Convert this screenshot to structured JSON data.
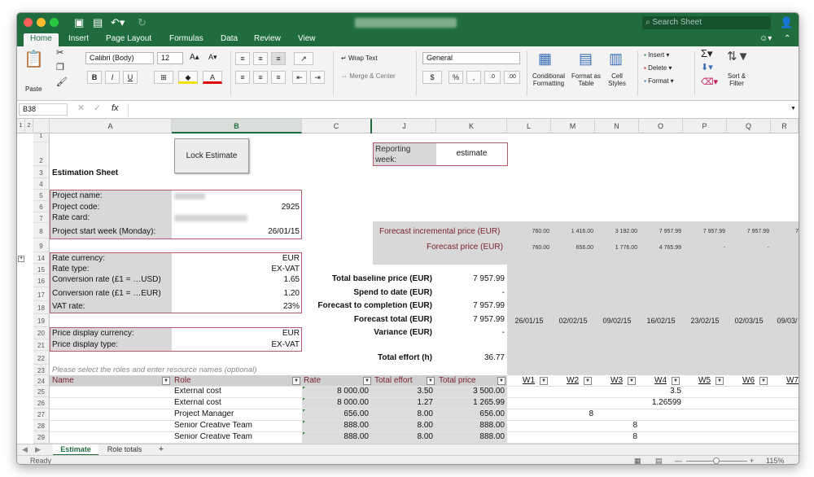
{
  "titlebar": {
    "search_placeholder": "Search Sheet"
  },
  "tabs": [
    "Home",
    "Insert",
    "Page Layout",
    "Formulas",
    "Data",
    "Review",
    "View"
  ],
  "ribbon": {
    "paste": "Paste",
    "font_name": "Calibri (Body)",
    "font_size": "12",
    "wrap_text": "Wrap Text",
    "merge_center": "Merge & Center",
    "number_format": "General",
    "conditional_formatting": "Conditional Formatting",
    "format_as_table": "Format as Table",
    "cell_styles": "Cell Styles",
    "insert": "Insert",
    "delete": "Delete",
    "format": "Format",
    "sort_filter": "Sort & Filter",
    "bold": "B",
    "italic": "I",
    "underline": "U",
    "percent": "%"
  },
  "formula_bar": {
    "name_box": "B38",
    "fx": "fx"
  },
  "columns": [
    "A",
    "B",
    "C",
    "J",
    "K",
    "L",
    "M",
    "N",
    "O",
    "P",
    "Q",
    "R"
  ],
  "outline_levels": [
    "1",
    "2"
  ],
  "rows": [
    "1",
    "2",
    "3",
    "4",
    "5",
    "6",
    "7",
    "8",
    "9",
    "14",
    "15",
    "16",
    "17",
    "18",
    "19",
    "20",
    "21",
    "22",
    "23",
    "24",
    "25",
    "26",
    "27",
    "28",
    "29"
  ],
  "lock_button": "Lock Estimate",
  "reporting_week_label": "Reporting week:",
  "reporting_week_value": "estimate",
  "sheet_title": "Estimation Sheet",
  "project": {
    "name_label": "Project name:",
    "code_label": "Project code:",
    "code_value": "2925",
    "rate_card_label": "Rate card:",
    "start_label": "Project start week (Monday):",
    "start_value": "26/01/15"
  },
  "currency": {
    "rate_currency_label": "Rate currency:",
    "rate_currency": "EUR",
    "rate_type_label": "Rate type:",
    "rate_type": "EX-VAT",
    "conv1_label": "Conversion rate (£1 = …USD)",
    "conv1": "1.65",
    "conv2_label": "Conversion rate (£1 = …EUR)",
    "conv2": "1.20",
    "vat_label": "VAT rate:",
    "vat": "23%",
    "display_currency_label": "Price display currency:",
    "display_currency": "EUR",
    "display_type_label": "Price display type:",
    "display_type": "EX-VAT"
  },
  "summary": [
    {
      "label": "Total baseline price (EUR)",
      "value": "7 957.99"
    },
    {
      "label": "Spend to date (EUR)",
      "value": "-"
    },
    {
      "label": "Forecast to completion (EUR)",
      "value": "7 957.99"
    },
    {
      "label": "Forecast total (EUR)",
      "value": "7 957.99"
    },
    {
      "label": "Variance (EUR)",
      "value": "-"
    }
  ],
  "total_effort_label": "Total effort (h)",
  "total_effort": "36.77",
  "forecast_incremental_label": "Forecast incremental price (EUR)",
  "forecast_incremental": [
    "760.00",
    "1 416.00",
    "3 192.00",
    "7 957.99",
    "7 957.99",
    "7 957.99",
    "7"
  ],
  "forecast_price_label": "Forecast price (EUR)",
  "forecast_price": [
    "760.00",
    "656.00",
    "1 776.00",
    "4 765.99",
    "-",
    "-",
    ""
  ],
  "week_dates": [
    "26/01/15",
    "02/02/15",
    "09/02/15",
    "16/02/15",
    "23/02/15",
    "02/03/15",
    "09/03/"
  ],
  "instruction": "Please select the roles and enter resource names (optional)",
  "table_headers": {
    "name": "Name",
    "role": "Role",
    "rate": "Rate",
    "total_effort": "Total effort",
    "total_price": "Total price"
  },
  "week_headers": [
    "W1",
    "W2",
    "W3",
    "W4",
    "W5",
    "W6",
    "W7"
  ],
  "table_rows": [
    {
      "role": "External cost",
      "rate": "8 000.00",
      "effort": "3.50",
      "price": "3 500.00"
    },
    {
      "role": "External cost",
      "rate": "8 000.00",
      "effort": "1.27",
      "price": "1 265.99"
    },
    {
      "role": "Project Manager",
      "rate": "656.00",
      "effort": "8.00",
      "price": "656.00"
    },
    {
      "role": "Senior Creative Team",
      "rate": "888.00",
      "effort": "8.00",
      "price": "888.00"
    },
    {
      "role": "Senior Creative Team",
      "rate": "888.00",
      "effort": "8.00",
      "price": "888.00"
    }
  ],
  "week_values": {
    "r25_w4": "3.5",
    "r26_w4": "1.26599",
    "r27_w2": "8",
    "r28_w3": "8",
    "r29_w3": "8"
  },
  "sheet_tabs": [
    "Estimate",
    "Role totals"
  ],
  "add_sheet": "+",
  "status": {
    "ready": "Ready",
    "zoom": "115%"
  },
  "colors": {
    "brand": "#1f6d3e",
    "header_text": "#7a1f2b",
    "accent_border": "#b55b6a"
  }
}
